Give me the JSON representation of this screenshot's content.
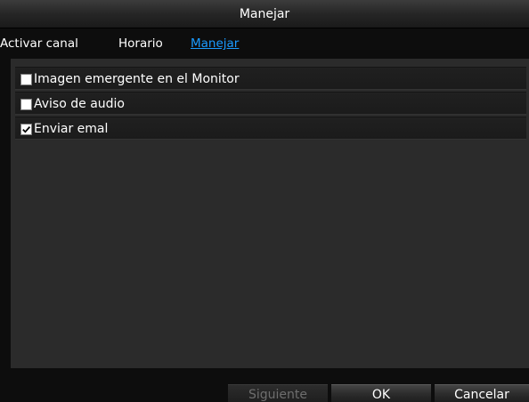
{
  "window": {
    "title": "Manejar"
  },
  "tabs": [
    {
      "label": "Activar canal",
      "active": false
    },
    {
      "label": "Horario",
      "active": false
    },
    {
      "label": "Manejar",
      "active": true
    }
  ],
  "options": [
    {
      "label": "Imagen emergente en el Monitor",
      "checked": false
    },
    {
      "label": "Aviso de audio",
      "checked": false
    },
    {
      "label": "Enviar emal",
      "checked": true
    }
  ],
  "footer": {
    "next_label": "Siguiente",
    "ok_label": "OK",
    "cancel_label": "Cancelar"
  },
  "colors": {
    "active_tab": "#1a9bff",
    "panel_bg": "#2b2b2b",
    "window_bg": "#0d0d0d"
  }
}
